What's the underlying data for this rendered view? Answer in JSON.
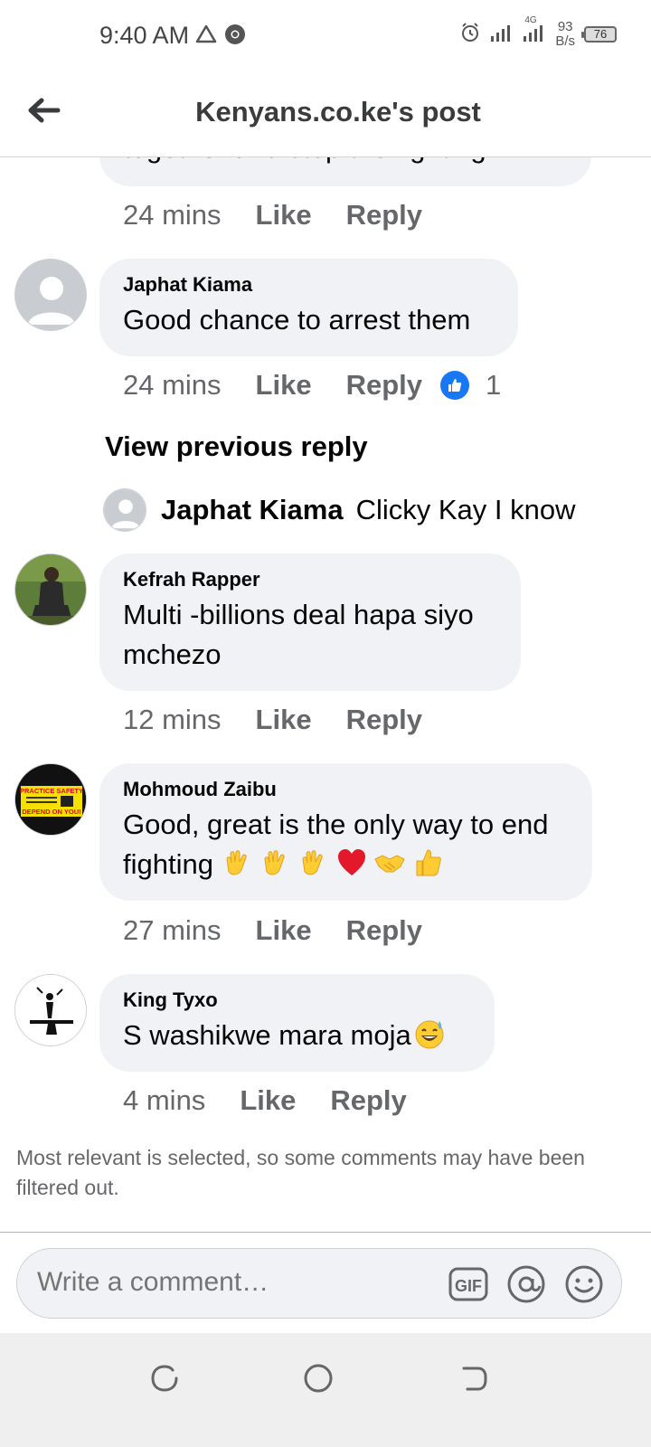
{
  "status_bar": {
    "time": "9:40 AM",
    "network_speed_value": "93",
    "network_speed_unit": "B/s",
    "battery": "76",
    "network_type": "4G"
  },
  "header": {
    "title": "Kenyans.co.ke's post"
  },
  "partial_comment": {
    "text": "together and stop the fighting.",
    "time": "24 mins",
    "like_label": "Like",
    "reply_label": "Reply"
  },
  "comments": [
    {
      "author": "Japhat Kiama",
      "text": "Good chance to arrest them",
      "time": "24 mins",
      "like_label": "Like",
      "reply_label": "Reply",
      "reaction_count": "1"
    },
    {
      "author": "Kefrah Rapper",
      "text": "Multi -billions deal hapa siyo mchezo",
      "time": "12 mins",
      "like_label": "Like",
      "reply_label": "Reply"
    },
    {
      "author": "Mohmoud Zaibu",
      "text": "Good, great is the only way to end fighting",
      "time": "27 mins",
      "like_label": "Like",
      "reply_label": "Reply",
      "emojis": [
        "clap",
        "clap",
        "clap",
        "heart",
        "handshake",
        "thumbs-up"
      ]
    },
    {
      "author": "King Tyxo",
      "text": "S washikwe mara moja",
      "time": "4 mins",
      "like_label": "Like",
      "reply_label": "Reply",
      "emojis": [
        "grinning-sweat"
      ]
    }
  ],
  "view_previous_reply": "View previous reply",
  "reply_preview": {
    "author": "Japhat Kiama",
    "text": "Clicky Kay I know"
  },
  "avatar_texts": {
    "mohmoud_badge_top": "PRACTICE SAFETY",
    "mohmoud_badge_bottom": "DEPEND ON YOU!"
  },
  "filter_note": "Most relevant is selected, so some comments may have been filtered out.",
  "composer": {
    "placeholder": "Write a comment…",
    "gif_label": "GIF"
  },
  "colors": {
    "bubble": "#f0f2f5",
    "meta_text": "#65676b",
    "like_blue": "#1877f2",
    "title_text": "#3a3b3c"
  }
}
